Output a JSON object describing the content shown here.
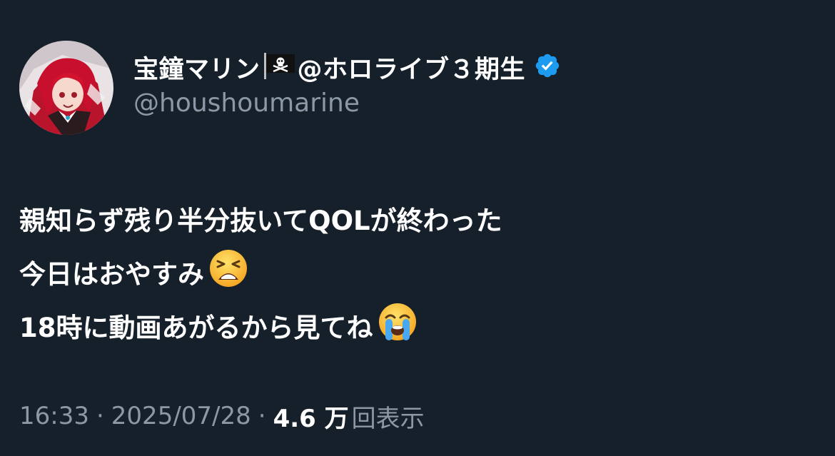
{
  "author": {
    "display_name": "宝鐘マリン",
    "flag_icon": "pirate-flag",
    "name_suffix": "@ホロライブ３期生",
    "handle": "@houshoumarine",
    "verified": true,
    "verified_color": "#1d9bf0"
  },
  "tweet": {
    "lines": [
      {
        "text": "親知らず残り半分抜いてQOLが終わった",
        "emoji": null
      },
      {
        "text": "今日はおやすみ",
        "emoji": "tired-face-emoji"
      },
      {
        "text": "18時に動画あがるから見てね",
        "emoji": "loudly-crying-face-emoji"
      }
    ]
  },
  "meta": {
    "time": "16:33",
    "separator": "·",
    "date": "2025/07/28",
    "views_count": "4.6 万",
    "views_label": "回表示"
  },
  "colors": {
    "background": "#15202b",
    "text": "#ffffff",
    "secondary_text": "#8b98a5"
  }
}
